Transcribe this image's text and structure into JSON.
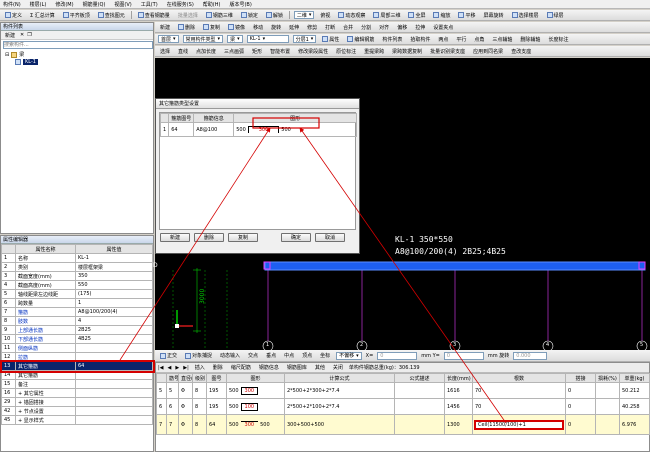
{
  "menu": [
    "构件(N)",
    "楼层(L)",
    "修改(M)",
    "钢筋量(Q)",
    "视图(V)",
    "工具(T)",
    "在线服务(S)",
    "帮助(H)",
    "版本号(B)"
  ],
  "toolbar1": [
    "定义",
    "Σ 汇总计算",
    "平齐板顶",
    "查找图元",
    "查看钢筋量",
    "批量选择",
    "钢筋三维",
    "锁定",
    "解锁",
    "二维",
    "俯视",
    "动态观察",
    "局部三维",
    "全屏",
    "缩放",
    "平移",
    "屏幕旋转",
    "选择楼层",
    "绿层"
  ],
  "toolbar2": [
    "新建",
    "删除",
    "复制",
    "镜像",
    "移动",
    "旋转",
    "延伸",
    "修剪",
    "打断",
    "合并",
    "分割",
    "对齐",
    "偏移",
    "拉伸",
    "设置夹点"
  ],
  "toolbar3": {
    "floor": "首层",
    "type": "常用构件类型",
    "comp": "梁",
    "name": "KL-1",
    "layer": "分层1",
    "items": [
      "属性",
      "编辑钢筋",
      "构件列表",
      "拾取构件",
      "两点",
      "平行",
      "点角",
      "三点辅轴",
      "删除辅轴",
      "长度标注"
    ]
  },
  "toolbar4": [
    "选择",
    "直线",
    "点加长度",
    "三点画弧",
    "矩形",
    "智能布置",
    "修改梁段属性",
    "原位标注",
    "重提梁跨",
    "梁跨数据复制",
    "批量识别梁支座",
    "应用到同名梁",
    "查改支座"
  ],
  "component_list": {
    "title": "构件列表",
    "new_label": "新建",
    "search_placeholder": "搜索构件...",
    "tree_root": "梁",
    "tree_item": "KL-1"
  },
  "props": {
    "title": "属性编辑器",
    "headers": [
      "属性名称",
      "属性值"
    ],
    "rows": [
      [
        "1",
        "名称",
        "KL-1"
      ],
      [
        "2",
        "类别",
        "楼层框架梁"
      ],
      [
        "3",
        "截面宽度(mm)",
        "350"
      ],
      [
        "4",
        "截面高度(mm)",
        "550"
      ],
      [
        "5",
        "轴线距梁左边线距",
        "(175)"
      ],
      [
        "6",
        "跨数量",
        "1"
      ],
      [
        "7",
        "箍筋",
        "A8@100/200(4)"
      ],
      [
        "8",
        "肢数",
        "4"
      ],
      [
        "9",
        "上部通长筋",
        "2B25"
      ],
      [
        "10",
        "下部通长筋",
        "4B25"
      ],
      [
        "11",
        "侧面纵筋",
        ""
      ],
      [
        "12",
        "拉筋",
        ""
      ],
      [
        "13",
        "其它箍筋",
        "64"
      ],
      [
        "14",
        "其它箍筋",
        ""
      ],
      [
        "15",
        "备注",
        ""
      ],
      [
        "16",
        "+ 其它属性",
        ""
      ],
      [
        "29",
        "+ 锚固搭接",
        ""
      ],
      [
        "42",
        "+ 节点设置",
        ""
      ],
      [
        "45",
        "+ 显示样式",
        ""
      ]
    ],
    "highlight_row": 12
  },
  "dialog": {
    "title": "其它箍筋类型设置",
    "headers": [
      "箍筋图号",
      "箍筋信息",
      "图形"
    ],
    "row": {
      "idx": "1",
      "no": "64",
      "info": "A8@100",
      "left": "500",
      "mid": "300",
      "right": "500"
    },
    "buttons": [
      "新建",
      "删除",
      "复制",
      "确定",
      "取消"
    ]
  },
  "canvas": {
    "label1": "KL-1 350*550",
    "label2": "A8@100/200(4) 2B25;4B25",
    "dim": "3000",
    "axes": [
      "1",
      "2",
      "3",
      "4",
      "5"
    ],
    "d_marker": "D"
  },
  "snapbar": [
    "正交",
    "对象捕捉",
    "动态输入",
    "交点",
    "垂点",
    "中点",
    "顶点",
    "坐标",
    "不偏移"
  ],
  "snap_inputs": {
    "x_label": "X=",
    "x_val": "0",
    "y_label": "mm Y=",
    "y_val": "0",
    "rot_label": "mm 旋转",
    "rot_val": "0.000"
  },
  "rebar": {
    "toolbar": [
      "插入",
      "删除",
      "缩尺配筋",
      "钢筋信息",
      "钢筋图库",
      "其他",
      "关闭"
    ],
    "summary": "单构件钢筋总重(kg)：306.139",
    "headers": [
      "筋号",
      "直径(mm)",
      "级别",
      "图号",
      "图形",
      "计算公式",
      "公式描述",
      "长度(mm)",
      "根数",
      "搭接",
      "损耗(%)",
      "单重(kg)",
      "总重(kg)"
    ],
    "rows": [
      {
        "idx": "5",
        "no": "5",
        "dia": "8",
        "grade": "Φ",
        "fig": "195",
        "shape_l": "500",
        "shape_r": "300",
        "formula": "2*500+2*300+2*7.4",
        "len": "1616",
        "count": "70",
        "lap": "0",
        "weight": "50.212"
      },
      {
        "idx": "6",
        "no": "6",
        "dia": "8",
        "grade": "Φ",
        "fig": "195",
        "shape_l": "500",
        "shape_r": "100",
        "formula": "2*500+2*100+2*7.4",
        "len": "1456",
        "count": "70",
        "lap": "0",
        "weight": "40.258"
      },
      {
        "idx": "7",
        "no": "7",
        "dia": "8",
        "grade": "Φ",
        "fig": "64",
        "shape_l": "500",
        "shape_m": "300",
        "shape_r": "500",
        "formula": "300+500+500",
        "len": "1300",
        "count": "Ceil(11500/100)+1",
        "lap": "0",
        "weight": "6.976"
      }
    ]
  },
  "colors": {
    "beam": "#1e5ff0",
    "axis": "#e63cff",
    "dim": "#00cc00",
    "highlight": "#d40000",
    "selected_row": "#0a246a"
  }
}
